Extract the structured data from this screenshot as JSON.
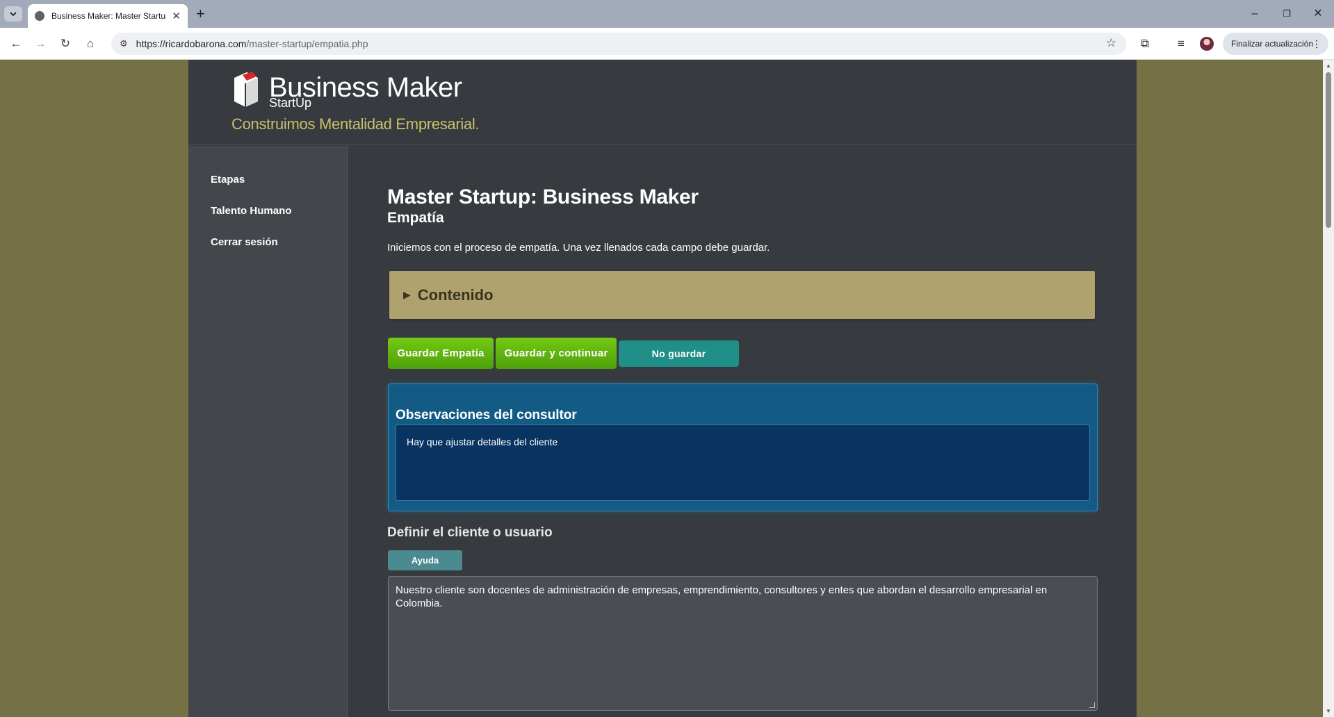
{
  "browser": {
    "tab_title": "Business Maker: Master Startup",
    "new_tab_symbol": "+",
    "url_host": "https://ricardobarona.com",
    "url_path": "/master-startup/empatia.php",
    "update_label": "Finalizar actualización"
  },
  "header": {
    "brand": "Business Maker",
    "brand_sub": "StartUp",
    "tagline": "Construimos Mentalidad Empresarial."
  },
  "sidebar": {
    "items": [
      {
        "label": "Etapas"
      },
      {
        "label": "Talento Humano"
      },
      {
        "label": "Cerrar sesión"
      }
    ]
  },
  "main": {
    "title": "Master Startup: Business Maker",
    "subtitle": "Empatía",
    "intro": "Iniciemos con el proceso de empatía. Una vez llenados cada campo debe guardar.",
    "accordion_label": "Contenido",
    "buttons": {
      "save": "Guardar Empatía",
      "save_continue": "Guardar y continuar",
      "no_save": "No guardar"
    },
    "observations": {
      "title": "Observaciones del consultor",
      "value": "Hay que ajustar detalles del cliente"
    },
    "client_section": {
      "title": "Definir el cliente o usuario",
      "help_label": "Ayuda",
      "value": "Nuestro cliente son docentes de administración de empresas, emprendimiento, consultores y entes que abordan el desarrollo empresarial en Colombia."
    }
  },
  "colors": {
    "page_bg": "#747245",
    "panel_bg": "#373a3f",
    "accent_green": "#5cb30d",
    "accent_teal": "#1f8f88",
    "accordion_bg": "#b0a26d",
    "observations_bg": "#135b84"
  }
}
